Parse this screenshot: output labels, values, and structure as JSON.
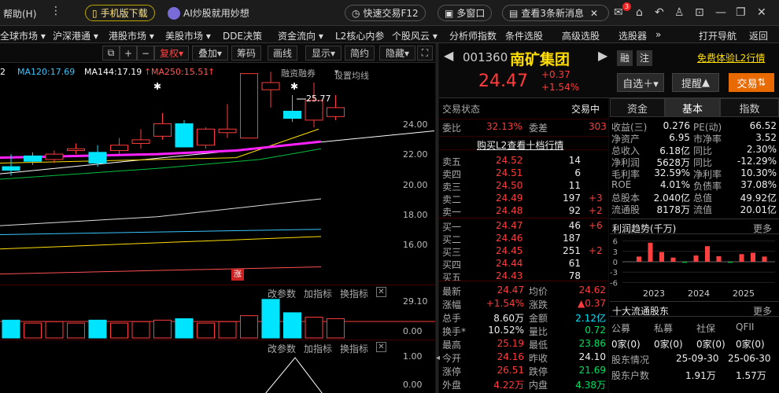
{
  "topbar": {
    "help_menu": "帮助(H)",
    "mobile_download": "手机版下载",
    "ai_label": "AI炒股就用妙想",
    "quick_trade": "快速交易F12",
    "multi_window": "多窗口",
    "news_notice": "查看3条新消息",
    "mail_badge": "3"
  },
  "navbar": {
    "items": [
      "全球市场 ▾",
      "沪深港通 ▾",
      "港股市场 ▾",
      "美股市场 ▾",
      "DDE决策",
      "资金流向 ▾",
      "L2核心内参",
      "个股风云 ▾",
      "分析师指数",
      "条件选股",
      "高级选股",
      "选股器",
      "»",
      "打开导航",
      "返回"
    ]
  },
  "chart_toolbar": {
    "rights": "复权",
    "overlay": "叠加",
    "chips": "筹码",
    "draw": "画线",
    "display": "显示",
    "brief": "简约",
    "hide": "隐藏"
  },
  "ma_legend": {
    "ma60": "2",
    "ma120": "MA120:17.69",
    "ma144": "MA144:17.19",
    "ma250": "MA250:15.51",
    "financing": "融资融券",
    "set_ma": "设置均线"
  },
  "chart_data": {
    "type": "candlestick",
    "y_ticks": [
      "24.00",
      "22.00",
      "20.00",
      "18.00",
      "16.00"
    ],
    "ylim": [
      14.7,
      27.0
    ],
    "high_marker": "25.77",
    "limit_up_badge": "涨",
    "candles": [
      {
        "o": 21.2,
        "c": 21.0,
        "h": 21.9,
        "l": 20.7
      },
      {
        "o": 21.8,
        "c": 21.5,
        "h": 22.0,
        "l": 21.3
      },
      {
        "o": 21.6,
        "c": 21.9,
        "h": 22.1,
        "l": 21.4
      },
      {
        "o": 22.1,
        "c": 22.2,
        "h": 22.5,
        "l": 21.9
      },
      {
        "o": 22.0,
        "c": 21.4,
        "h": 22.4,
        "l": 21.2
      },
      {
        "o": 22.1,
        "c": 22.4,
        "h": 22.8,
        "l": 21.9
      },
      {
        "o": 22.5,
        "c": 22.7,
        "h": 23.3,
        "l": 22.2
      },
      {
        "o": 22.9,
        "c": 23.6,
        "h": 24.2,
        "l": 22.7
      },
      {
        "o": 23.6,
        "c": 22.3,
        "h": 23.8,
        "l": 22.3
      },
      {
        "o": 22.4,
        "c": 23.3,
        "h": 23.4,
        "l": 22.2
      },
      {
        "o": 23.1,
        "c": 23.3,
        "h": 24.7,
        "l": 22.8
      },
      {
        "o": 22.8,
        "c": 26.4,
        "h": 26.4,
        "l": 22.8
      },
      {
        "o": 25.5,
        "c": 25.9,
        "h": 26.5,
        "l": 24.5
      },
      {
        "o": 24.3,
        "c": 23.9,
        "h": 25.2,
        "l": 23.7
      },
      {
        "o": 23.8,
        "c": 24.9,
        "h": 25.9,
        "l": 23.4
      },
      {
        "o": 24.0,
        "c": 24.5,
        "h": 25.2,
        "l": 23.8
      }
    ],
    "volume_labels": [
      "29.10",
      "0.00"
    ],
    "volume": [
      {
        "v": 12,
        "up": false
      },
      {
        "v": 10,
        "up": true
      },
      {
        "v": 11,
        "up": true
      },
      {
        "v": 10,
        "up": true
      },
      {
        "v": 12,
        "up": false
      },
      {
        "v": 10,
        "up": true
      },
      {
        "v": 11,
        "up": true
      },
      {
        "v": 12,
        "up": true
      },
      {
        "v": 13,
        "up": false
      },
      {
        "v": 10,
        "up": true
      },
      {
        "v": 11,
        "up": true
      },
      {
        "v": 15,
        "up": true
      },
      {
        "v": 26,
        "up": false
      },
      {
        "v": 17,
        "up": false
      },
      {
        "v": 14,
        "up": true
      },
      {
        "v": 13,
        "up": true
      }
    ],
    "indicator_labels": [
      "1.00",
      "0.00"
    ]
  },
  "panel_labels": {
    "change_param": "改参数",
    "add_indicator": "加指标",
    "swap_indicator": "换指标"
  },
  "stock": {
    "code": "001360",
    "name": "南矿集团",
    "price": "24.47",
    "change": "+0.37",
    "change_pct": "+1.54%",
    "tag_margin": "融",
    "tag_note": "注",
    "l2_trial": "免费体验L2行情",
    "add_favorite": "自选",
    "alert": "提醒",
    "trade": "交易"
  },
  "trade": {
    "status_label": "交易状态",
    "status_value": "交易中",
    "ratio_label": "委比",
    "ratio_value": "32.13%",
    "diff_label": "委差",
    "diff_value": "303",
    "l2_link": "购买L2查看十档行情",
    "asks": [
      {
        "label": "卖五",
        "price": "24.52",
        "vol": "14",
        "chg": ""
      },
      {
        "label": "卖四",
        "price": "24.51",
        "vol": "6",
        "chg": ""
      },
      {
        "label": "卖三",
        "price": "24.50",
        "vol": "11",
        "chg": ""
      },
      {
        "label": "卖二",
        "price": "24.49",
        "vol": "197",
        "chg": "+3"
      },
      {
        "label": "卖一",
        "price": "24.48",
        "vol": "92",
        "chg": "+2"
      }
    ],
    "bids": [
      {
        "label": "买一",
        "price": "24.47",
        "vol": "46",
        "chg": "+6"
      },
      {
        "label": "买二",
        "price": "24.46",
        "vol": "187",
        "chg": ""
      },
      {
        "label": "买三",
        "price": "24.45",
        "vol": "251",
        "chg": "+2"
      },
      {
        "label": "买四",
        "price": "24.44",
        "vol": "61",
        "chg": ""
      },
      {
        "label": "买五",
        "price": "24.43",
        "vol": "78",
        "chg": ""
      }
    ],
    "stats": [
      {
        "l1": "最新",
        "v1": "24.47",
        "c1": "red",
        "l2": "均价",
        "v2": "24.62",
        "c2": "red"
      },
      {
        "l1": "涨幅",
        "v1": "+1.54%",
        "c1": "red",
        "l2": "涨跌",
        "v2": "▲0.37",
        "c2": "red"
      },
      {
        "l1": "总手",
        "v1": "8.60万",
        "c1": "white",
        "l2": "金额",
        "v2": "2.12亿",
        "c2": "cyan"
      },
      {
        "l1": "换手*",
        "v1": "10.52%",
        "c1": "white",
        "l2": "量比",
        "v2": "0.72",
        "c2": "green"
      },
      {
        "l1": "最高",
        "v1": "25.19",
        "c1": "red",
        "l2": "最低",
        "v2": "23.86",
        "c2": "green"
      },
      {
        "l1": "今开",
        "v1": "24.16",
        "c1": "red",
        "l2": "昨收",
        "v2": "24.10",
        "c2": "white"
      },
      {
        "l1": "涨停",
        "v1": "26.51",
        "c1": "red",
        "l2": "跌停",
        "v2": "21.69",
        "c2": "green"
      },
      {
        "l1": "外盘",
        "v1": "4.22万",
        "c1": "red",
        "l2": "内盘",
        "v2": "4.38万",
        "c2": "green"
      }
    ]
  },
  "fund": {
    "tabs": [
      "资金",
      "基本",
      "指数"
    ],
    "rows": [
      {
        "l1": "收益(三)",
        "v1": "0.276",
        "l2": "PE(动)",
        "v2": "66.52"
      },
      {
        "l1": "净资产",
        "v1": "6.95",
        "l2": "市净率",
        "v2": "3.52"
      },
      {
        "l1": "总收入",
        "v1": "6.18亿",
        "l2": "同比",
        "v2": "2.30%"
      },
      {
        "l1": "净利润",
        "v1": "5628万",
        "l2": "同比",
        "v2": "-12.29%"
      },
      {
        "l1": "毛利率",
        "v1": "32.59%",
        "l2": "净利率",
        "v2": "10.30%"
      },
      {
        "l1": "ROE",
        "v1": "4.01%",
        "l2": "负债率",
        "v2": "37.08%"
      },
      {
        "l1": "总股本",
        "v1": "2.040亿",
        "l2": "总值",
        "v2": "49.92亿"
      },
      {
        "l1": "流通股",
        "v1": "8178万",
        "l2": "流值",
        "v2": "20.01亿"
      }
    ],
    "profit_title": "利润趋势(千万)",
    "more": "更多",
    "profit_y": [
      "6",
      "3",
      "0",
      "-3",
      "-6"
    ],
    "profit_years": [
      "2023",
      "2024",
      "2025"
    ],
    "profit_bars": [
      1.5,
      5.5,
      2.8,
      1.2,
      -0.3,
      1.8,
      4.5,
      1.6,
      -0.3,
      2.2,
      2.6,
      1.5
    ],
    "holders_title": "十大流通股东",
    "holders_cols": [
      "公募",
      "私募",
      "社保",
      "QFII"
    ],
    "holders_vals": [
      "0家(0)",
      "0家(0)",
      "0家(0)",
      "0家(0)"
    ],
    "holders_date_label": "股东情况",
    "holders_date1": "25-09-30",
    "holders_date2": "25-06-30",
    "holders_count_label": "股东户数",
    "holders_count1": "1.91万",
    "holders_count2": "1.57万",
    "colors": {
      "up": "#ff3b3b",
      "down": "#00e5ff",
      "bar": "#ff4040"
    }
  }
}
